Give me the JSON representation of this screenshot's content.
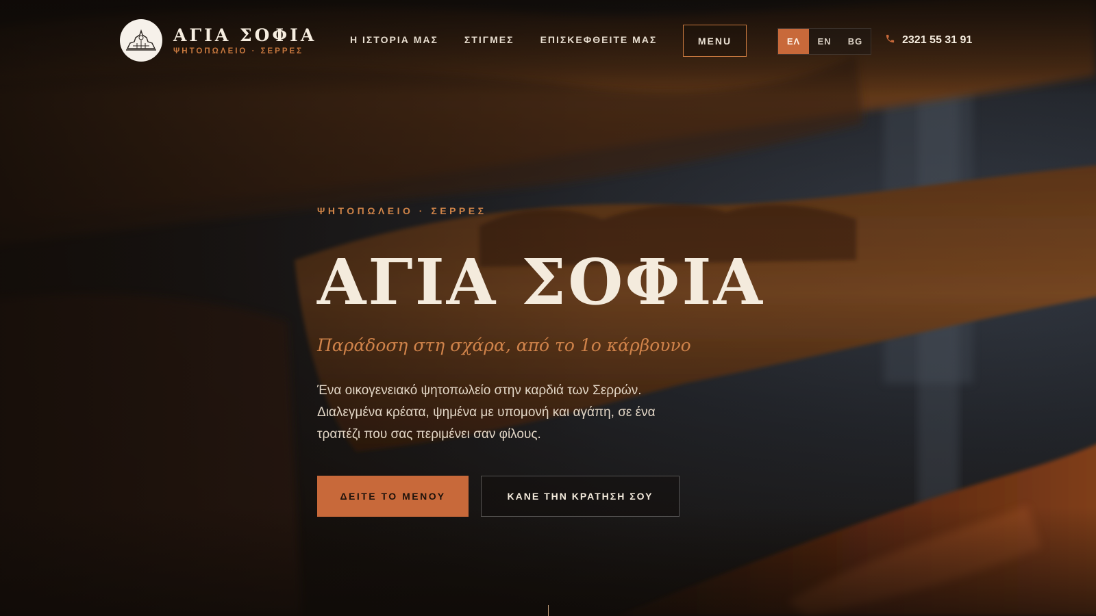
{
  "brand": {
    "name": "ΑΓΙΑ ΣΟΦΙΑ",
    "subtitle": "ΨΗΤΟΠΩΛΕΙΟ · ΣΕΡΡΕΣ",
    "logo_icon": "church-sketch-icon"
  },
  "nav": {
    "items": [
      {
        "label": "Η ΙΣΤΟΡΙΑ ΜΑΣ"
      },
      {
        "label": "ΣΤΙΓΜΕΣ"
      },
      {
        "label": "ΕΠΙΣΚΕΦΘΕΙΤΕ ΜΑΣ"
      }
    ],
    "menu_label": "MENU"
  },
  "languages": {
    "options": [
      "ΕΛ",
      "EN",
      "BG"
    ],
    "active": "ΕΛ"
  },
  "contact": {
    "phone": "2321 55 31 91",
    "phone_icon": "phone-icon"
  },
  "hero": {
    "eyebrow": "ΨΗΤΟΠΩΛΕΙΟ · ΣΕΡΡΕΣ",
    "title": "ΑΓΙΑ ΣΟΦΙΑ",
    "tagline": "Παράδοση στη σχάρα, από το 1ο κάρβουνο",
    "description": "Ένα οικογενειακό ψητοπωλείο στην καρδιά των Σερρών. Διαλεγμένα κρέατα, ψημένα με υπομονή και αγάπη, σε ένα τραπέζι που σας περιμένει σαν φίλους.",
    "primary_cta": "ΔΕΙΤΕ ΤΟ ΜΕΝΟΥ",
    "secondary_cta": "ΚΑΝΕ ΤΗΝ ΚΡΑΤΗΣΗ ΣΟΥ"
  },
  "colors": {
    "accent": "#c8693a",
    "accent_text": "#d0834a",
    "title": "#f4ebdd"
  }
}
